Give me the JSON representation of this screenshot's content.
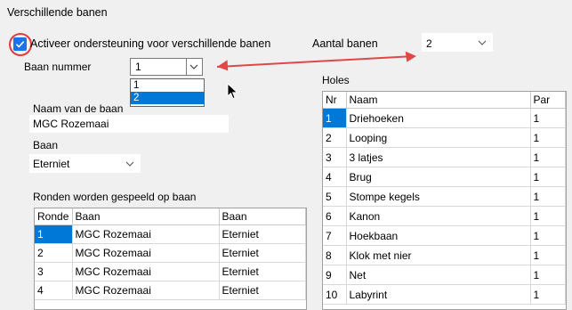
{
  "section_title": "Verschillende banen",
  "activate_checkbox": {
    "label": "Activeer ondersteuning voor verschillende banen",
    "checked": true
  },
  "aantal_banen": {
    "label": "Aantal banen",
    "value": "2"
  },
  "baan_nummer": {
    "label": "Baan nummer",
    "value": "1",
    "options": [
      "1",
      "2"
    ],
    "highlighted": "2"
  },
  "naam_van_de_baan": {
    "label": "Naam van de baan",
    "value": "MGC Rozemaai"
  },
  "baan": {
    "label": "Baan",
    "value": "Eterniet"
  },
  "rondes": {
    "label": "Ronden worden gespeeld op baan",
    "headers": [
      "Ronde",
      "Baan",
      "Baan"
    ],
    "rows": [
      [
        "1",
        "MGC Rozemaai",
        "Eterniet"
      ],
      [
        "2",
        "MGC Rozemaai",
        "Eterniet"
      ],
      [
        "3",
        "MGC Rozemaai",
        "Eterniet"
      ],
      [
        "4",
        "MGC Rozemaai",
        "Eterniet"
      ]
    ]
  },
  "holes": {
    "label": "Holes",
    "headers": [
      "Nr",
      "Naam",
      "Par"
    ],
    "rows": [
      [
        "1",
        "Driehoeken",
        "1"
      ],
      [
        "2",
        "Looping",
        "1"
      ],
      [
        "3",
        "3 latjes",
        "1"
      ],
      [
        "4",
        "Brug",
        "1"
      ],
      [
        "5",
        "Stompe kegels",
        "1"
      ],
      [
        "6",
        "Kanon",
        "1"
      ],
      [
        "7",
        "Hoekbaan",
        "1"
      ],
      [
        "8",
        "Klok met nier",
        "1"
      ],
      [
        "9",
        "Net",
        "1"
      ],
      [
        "10",
        "Labyrint",
        "1"
      ]
    ]
  },
  "colors": {
    "accent": "#0078d7",
    "annotation": "#e23b3b"
  }
}
